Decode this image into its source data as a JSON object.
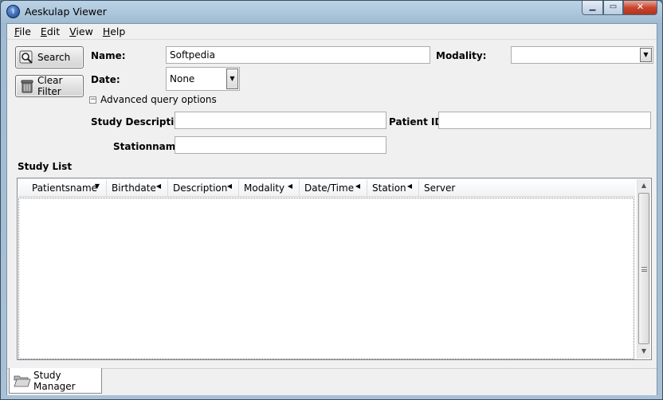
{
  "window": {
    "title": "Aeskulap Viewer"
  },
  "menu": [
    {
      "label": "File",
      "accel": "F",
      "rest": "ile"
    },
    {
      "label": "Edit",
      "accel": "E",
      "rest": "dit"
    },
    {
      "label": "View",
      "accel": "V",
      "rest": "iew"
    },
    {
      "label": "Help",
      "accel": "H",
      "rest": "elp"
    }
  ],
  "buttons": {
    "search": "Search",
    "clear_filter": "Clear Filter"
  },
  "query": {
    "name_label": "Name:",
    "name_value": "Softpedia",
    "modality_label": "Modality:",
    "modality_value": "",
    "date_label": "Date:",
    "date_value": "None",
    "advanced_toggle": "Advanced query options",
    "advanced_toggle_symbol": "−",
    "study_description_label": "Study Description:",
    "study_description_value": "",
    "patient_id_label": "Patient ID:",
    "patient_id_value": "",
    "stationname_label": "Stationname:",
    "stationname_value": ""
  },
  "study_list": {
    "label": "Study List",
    "columns": [
      {
        "label": "Patientsname",
        "sort": "▼"
      },
      {
        "label": "Birthdate",
        "sort": "◀"
      },
      {
        "label": "Description",
        "sort": "◀"
      },
      {
        "label": "Modality",
        "sort": "◀"
      },
      {
        "label": "Date/Time",
        "sort": "◀"
      },
      {
        "label": "Station",
        "sort": "◀"
      },
      {
        "label": "Server",
        "sort": ""
      }
    ],
    "rows": []
  },
  "tabs": [
    {
      "label": "Study Manager"
    }
  ]
}
